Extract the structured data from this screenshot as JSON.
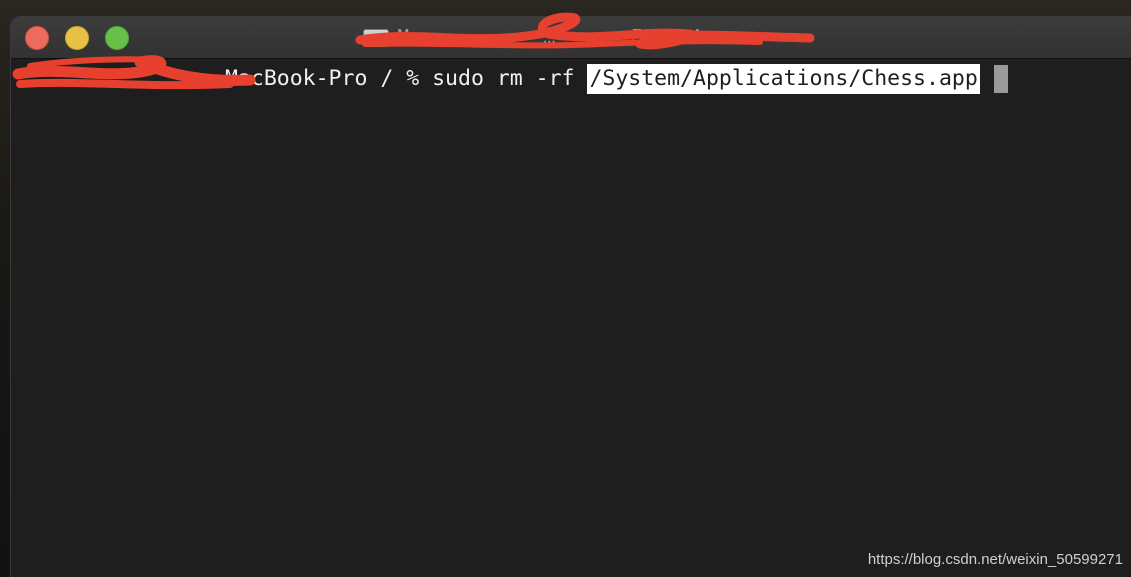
{
  "window": {
    "title_visible": "M…  …  …  …  …  50×24",
    "title_icon": "disk-icon",
    "traffic_lights": {
      "close_color": "#ec6a5e",
      "minimize_color": "#e6c244",
      "zoom_color": "#67c04a"
    }
  },
  "terminal": {
    "prompt_host": "MacBook-Pro / % ",
    "command": "sudo rm -rf ",
    "selected_path": "/System/Applications/Chess.app",
    "cursor": "block",
    "background": "#1e1e1e",
    "foreground": "#f0f0f0",
    "selection_background": "#ffffff"
  },
  "watermark": {
    "text": "https://blog.csdn.net/weixin_50599271"
  },
  "redaction_color": "#e8402f"
}
